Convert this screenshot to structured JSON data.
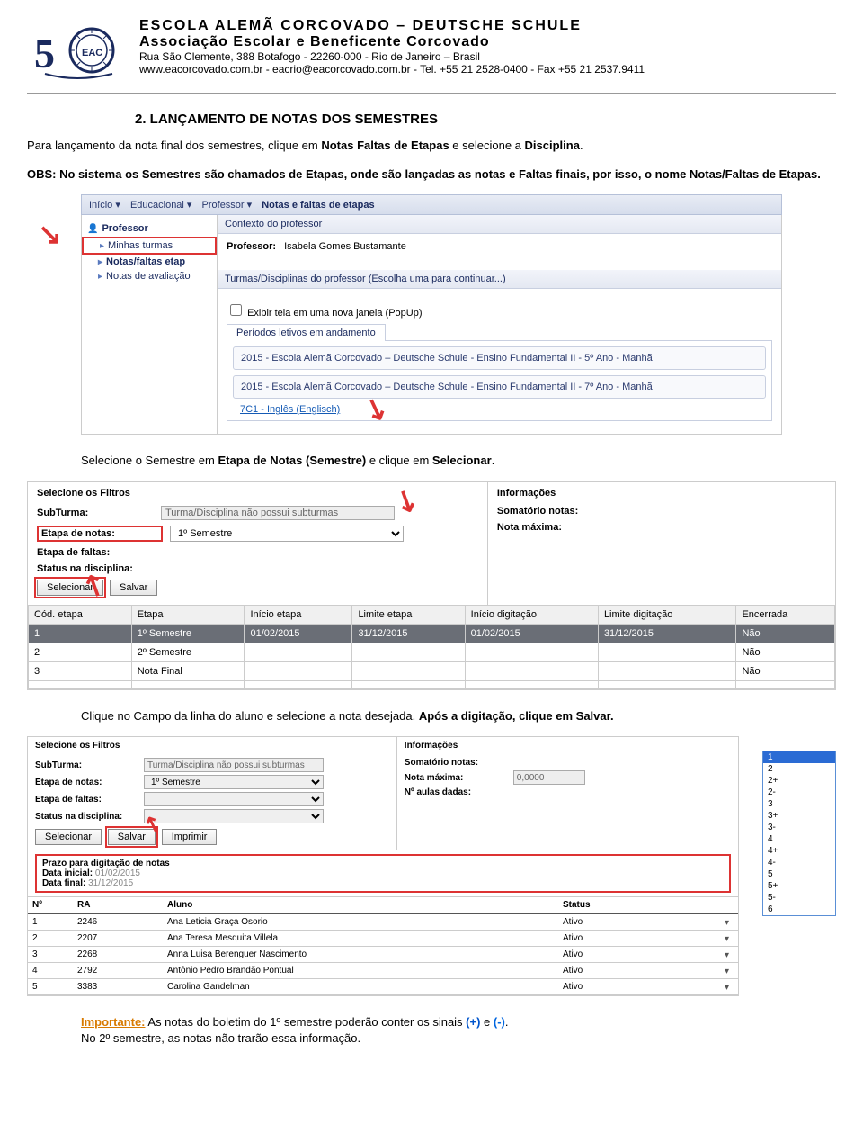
{
  "letterhead": {
    "line1": "ESCOLA ALEMÃ CORCOVADO – DEUTSCHE SCHULE",
    "line2": "Associação Escolar e Beneficente Corcovado",
    "line3": "Rua São Clemente, 388   Botafogo  -  22260-000  - Rio de Janeiro – Brasil",
    "line4": "www.eacorcovado.com.br - eacrio@eacorcovado.com.br -  Tel. +55 21 2528-0400 - Fax +55 21 2537.9411"
  },
  "section_title": "2. LANÇAMENTO DE NOTAS DOS SEMESTRES",
  "para1_a": "Para lançamento da nota final dos semestres, clique em ",
  "para1_b": "Notas Faltas de Etapas",
  "para1_c": " e selecione a ",
  "para1_d": "Disciplina",
  "para1_e": ".",
  "para2": "OBS: No sistema os Semestres são chamados de Etapas, onde são lançadas as notas e Faltas finais, por isso, o nome Notas/Faltas de Etapas.",
  "shot1": {
    "crumb1": "Início ▾",
    "crumb2": "Educacional ▾",
    "crumb3": "Professor ▾",
    "crumb4": "Notas e faltas de etapas",
    "side_title": "Professor",
    "side_items": [
      "Minhas turmas",
      "Notas/faltas etap",
      "Notas de avaliação"
    ],
    "panel1": "Contexto do professor",
    "prof_label": "Professor:",
    "prof_name": "Isabela Gomes Bustamante",
    "panel2": "Turmas/Disciplinas do professor (Escolha uma para continuar...)",
    "popup_label": "Exibir tela em uma nova janela (PopUp)",
    "tab_label": "Períodos letivos em andamento",
    "turma1": "2015 - Escola Alemã Corcovado – Deutsche Schule - Ensino Fundamental II - 5º Ano - Manhã",
    "turma2": "2015 - Escola Alemã Corcovado – Deutsche Schule - Ensino Fundamental II - 7º Ano - Manhã",
    "turma2_sub": "7C1 - Inglês (Englisch)"
  },
  "mid_text_a": "Selecione o Semestre em ",
  "mid_text_b": "Etapa de Notas (Semestre) ",
  "mid_text_c": "e clique em ",
  "mid_text_d": "Selecionar",
  "mid_text_e": ".",
  "shot2": {
    "filters_title": "Selecione os Filtros",
    "info_title": "Informações",
    "subturma_label": "SubTurma:",
    "subturma_value": "Turma/Disciplina não possui subturmas",
    "etapanotas_label": "Etapa de notas:",
    "etapanotas_value": "1º Semestre",
    "etapafaltas_label": "Etapa de faltas:",
    "status_label": "Status na disciplina:",
    "somatorio_label": "Somatório notas:",
    "notamax_label": "Nota máxima:",
    "btn_selecionar": "Selecionar",
    "btn_salvar": "Salvar",
    "cols": [
      "Cód. etapa",
      "Etapa",
      "Início etapa",
      "Limite etapa",
      "Início digitação",
      "Limite digitação",
      "Encerrada"
    ],
    "rows": [
      [
        "1",
        "1º Semestre",
        "01/02/2015",
        "31/12/2015",
        "01/02/2015",
        "31/12/2015",
        "Não"
      ],
      [
        "2",
        "2º Semestre",
        "",
        "",
        "",
        "",
        "Não"
      ],
      [
        "3",
        "Nota Final",
        "",
        "",
        "",
        "",
        "Não"
      ],
      [
        "",
        "",
        "",
        "",
        "",
        "",
        ""
      ]
    ]
  },
  "mid2_a": "Clique no Campo da linha do aluno e selecione a nota desejada. ",
  "mid2_b": "Após a digitação, clique em Salvar.",
  "shot3": {
    "filters_title": "Selecione os Filtros",
    "info_title": "Informações",
    "subturma_label": "SubTurma:",
    "subturma_value": "Turma/Disciplina não possui subturmas",
    "etapanotas_label": "Etapa de notas:",
    "etapanotas_value": "1º Semestre",
    "etapafaltas_label": "Etapa de faltas:",
    "status_label": "Status na disciplina:",
    "somatorio_label": "Somatório notas:",
    "notamax_label": "Nota máxima:",
    "notamax_value": "0,0000",
    "naulas_label": "Nº aulas dadas:",
    "btn_selecionar": "Selecionar",
    "btn_salvar": "Salvar",
    "btn_imprimir": "Imprimir",
    "prazo_title": "Prazo para digitação de notas",
    "prazo_ini_l": "Data inicial:",
    "prazo_ini_v": "01/02/2015",
    "prazo_fim_l": "Data final:",
    "prazo_fim_v": "31/12/2015",
    "nota_options": [
      "1",
      "2",
      "2+",
      "2-",
      "3",
      "3+",
      "3-",
      "4",
      "4+",
      "4-",
      "5",
      "5+",
      "5-",
      "6"
    ],
    "aluno_cols": [
      "Nº",
      "RA",
      "Aluno",
      "Status"
    ],
    "alunos": [
      [
        "1",
        "2246",
        "Ana Leticia Graça Osorio",
        "Ativo"
      ],
      [
        "2",
        "2207",
        "Ana Teresa Mesquita Villela",
        "Ativo"
      ],
      [
        "3",
        "2268",
        "Anna Luisa Berenguer Nascimento",
        "Ativo"
      ],
      [
        "4",
        "2792",
        "Antônio Pedro Brandão Pontual",
        "Ativo"
      ],
      [
        "5",
        "3383",
        "Carolina Gandelman",
        "Ativo"
      ]
    ]
  },
  "footer_a": "Importante:",
  "footer_b": "  As notas do boletim do 1º semestre poderão conter os sinais  ",
  "footer_c": "(+)",
  "footer_d": "  e  ",
  "footer_e": "(-)",
  "footer_f": ".",
  "footer_g": "No 2º semestre, as notas não trarão essa informação."
}
